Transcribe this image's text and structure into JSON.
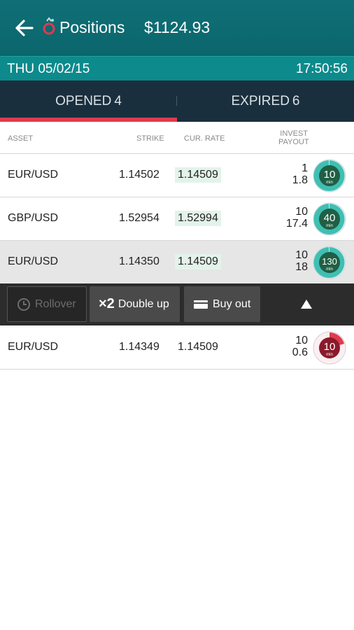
{
  "header": {
    "title": "Positions",
    "balance": "$1124.93"
  },
  "datebar": {
    "date": "THU 05/02/15",
    "time": "17:50:56"
  },
  "tabs": [
    {
      "label": "OPENED",
      "count": "4"
    },
    {
      "label": "EXPIRED",
      "count": "6"
    }
  ],
  "columns": {
    "asset": "ASSET",
    "strike": "STRIKE",
    "cur_rate": "CUR. RATE",
    "invest": "INVEST",
    "payout": "PAYOUT"
  },
  "rows": [
    {
      "asset": "EUR/USD",
      "strike": "1.14502",
      "cur_rate": "1.14509",
      "invest": "1",
      "payout": "1.8",
      "timer_value": "10",
      "timer_unit": "min"
    },
    {
      "asset": "GBP/USD",
      "strike": "1.52954",
      "cur_rate": "1.52994",
      "invest": "10",
      "payout": "17.4",
      "timer_value": "40",
      "timer_unit": "min"
    },
    {
      "asset": "EUR/USD",
      "strike": "1.14350",
      "cur_rate": "1.14509",
      "invest": "10",
      "payout": "18",
      "timer_value": "130",
      "timer_unit": "min"
    },
    {
      "asset": "EUR/USD",
      "strike": "1.14349",
      "cur_rate": "1.14509",
      "invest": "10",
      "payout": "0.6",
      "timer_value": "10",
      "timer_unit": "min"
    }
  ],
  "actions": {
    "rollover": "Rollover",
    "double_up_prefix": "×2",
    "double_up": "Double up",
    "buy_out": "Buy out"
  },
  "colors": {
    "teal": "#0d8a8c",
    "tab_bg": "#1a2f3e",
    "accent_red": "#e03a4e",
    "timer_green": "#1f5f45",
    "timer_red": "#8a1a2a",
    "highlight": "#e3f3ea"
  },
  "icons": [
    "back-arrow-icon",
    "app-logo-icon",
    "clock-icon",
    "double-icon",
    "card-icon",
    "chevron-up-icon"
  ]
}
